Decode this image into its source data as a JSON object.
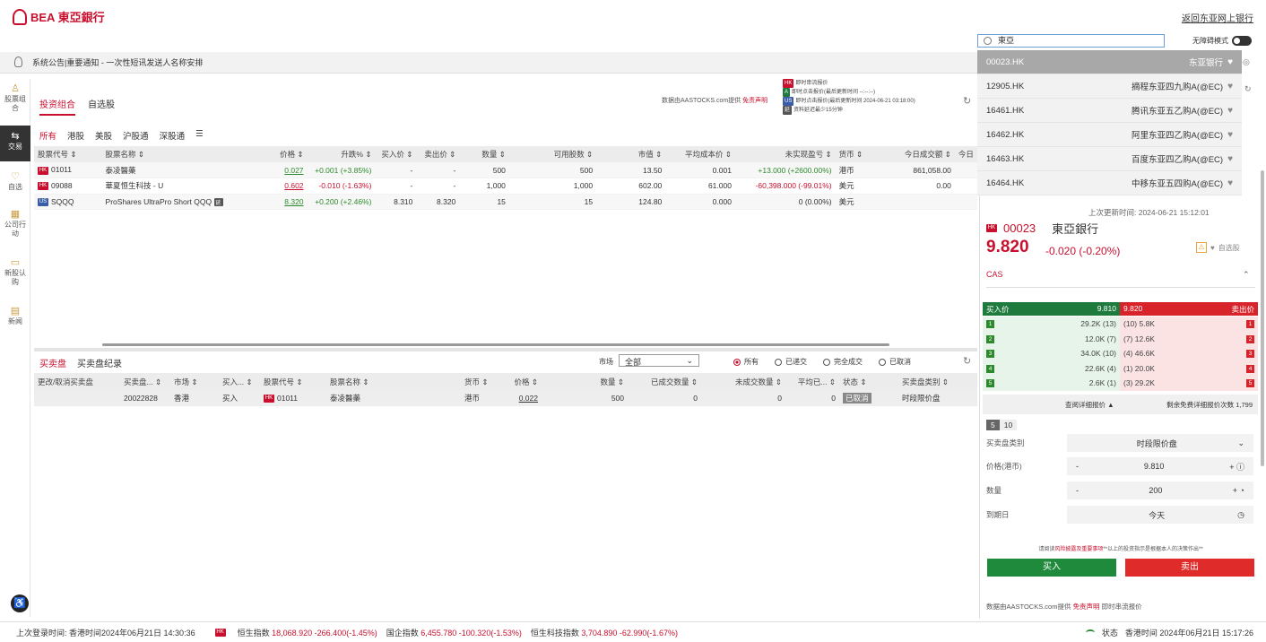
{
  "app": {
    "logo_text": "BEA 東亞銀行",
    "back_link": "返回东亚网上银行",
    "barrier_free": "无障碍模式"
  },
  "search": {
    "value": "東亞"
  },
  "notice": {
    "text": "系统公告|重要通知 - 一次性短讯发送人名称安排"
  },
  "sidebar": {
    "items": [
      {
        "label": "股票组合",
        "icon": "person-icon"
      },
      {
        "label": "交易",
        "icon": "trade-icon"
      },
      {
        "label": "自选",
        "icon": "heart-icon"
      },
      {
        "label": "公司行动",
        "icon": "calendar-icon"
      },
      {
        "label": "新股认购",
        "icon": "ipo-icon"
      },
      {
        "label": "新闻",
        "icon": "news-icon"
      }
    ]
  },
  "tabs": [
    "投资组合",
    "自选股"
  ],
  "legend": [
    {
      "badge": "HK",
      "text": "即时串流报价"
    },
    {
      "badge": "A",
      "text": "即时点击报价(最后更新时间 --:--:--)"
    },
    {
      "badge": "US",
      "text": "即时点击报价(最后更新时间 2024-06-21 03:18:00)"
    },
    {
      "badge": "延",
      "text": "资料延迟最少15分钟"
    }
  ],
  "aastocks": {
    "prefix": "数据由AASTOCKS.com提供",
    "link": "免责声明"
  },
  "markets": [
    "所有",
    "港股",
    "美股",
    "沪股通",
    "深股通",
    "☰"
  ],
  "portfolio": {
    "headers": [
      "股票代号 ⇕",
      "股票名称 ⇕",
      "价格 ⇕",
      "升跌% ⇕",
      "买入价 ⇕",
      "卖出价 ⇕",
      "数量 ⇕",
      "可用股数 ⇕",
      "市值 ⇕",
      "平均成本价 ⇕",
      "未实现盈亏 ⇕",
      "货币 ⇕",
      "今日成交额 ⇕",
      "今日"
    ],
    "rows": [
      {
        "mkt": "HK",
        "code": "01011",
        "name": "泰凌醫藥",
        "price": "0.027",
        "chg": "+0.001 (+3.85%)",
        "bid": "-",
        "ask": "-",
        "qty": "500",
        "avail": "500",
        "mv": "13.50",
        "cost": "0.001",
        "pl": "+13.000 (+2600.00%)",
        "ccy": "港币",
        "turnover": "861,058.00"
      },
      {
        "mkt": "HK",
        "code": "09088",
        "name": "華夏恒生科技 - U",
        "price": "0.602",
        "chg": "-0.010 (-1.63%)",
        "bid": "-",
        "ask": "-",
        "qty": "1,000",
        "avail": "1,000",
        "mv": "602.00",
        "cost": "61.000",
        "pl": "-60,398.000 (-99.01%)",
        "ccy": "美元",
        "turnover": "0.00"
      },
      {
        "mkt": "US",
        "code": "SQQQ",
        "name": "ProShares UltraPro Short QQQ",
        "price": "8.320",
        "chg": "+0.200 (+2.46%)",
        "bid": "8.310",
        "ask": "8.320",
        "qty": "15",
        "avail": "15",
        "mv": "124.80",
        "cost": "0.000",
        "pl": "0 (0.00%)",
        "ccy": "美元",
        "turnover": ""
      }
    ]
  },
  "orders": {
    "tabs": [
      "买卖盘",
      "买卖盘纪录"
    ],
    "market_label": "市场",
    "market_value": "全部",
    "filters": [
      "所有",
      "已递交",
      "完全成交",
      "已取消"
    ],
    "headers": [
      "更改/取消买卖盘",
      "买卖盘... ⇕",
      "市场 ⇕",
      "买入... ⇕",
      "股票代号 ⇕",
      "股票名称 ⇕",
      "货币 ⇕",
      "价格 ⇕",
      "数量 ⇕",
      "已成交数量 ⇕",
      "未成交数量 ⇕",
      "平均已... ⇕",
      "状态 ⇕",
      "买卖盘类别 ⇕"
    ],
    "rows": [
      {
        "action": "",
        "id": "20022828",
        "market": "香港",
        "side": "买入",
        "mkt": "HK",
        "code": "01011",
        "name": "泰凌醫藥",
        "ccy": "港币",
        "price": "0.022",
        "qty": "500",
        "filled": "0",
        "unfilled": "0",
        "avg": "0",
        "status": "已取消",
        "type": "时段限价盘"
      }
    ]
  },
  "search_results": [
    {
      "code": "00023.HK",
      "name": "东亚银行"
    },
    {
      "code": "12905.HK",
      "name": "摘程东亚四九购A(@EC)"
    },
    {
      "code": "16461.HK",
      "name": "腾讯东亚五乙购A(@EC)"
    },
    {
      "code": "16462.HK",
      "name": "阿里东亚四乙购A(@EC)"
    },
    {
      "code": "16463.HK",
      "name": "百度东亚四乙购A(@EC)"
    },
    {
      "code": "16464.HK",
      "name": "中移东亚五四购A(@EC)"
    }
  ],
  "quote": {
    "last_update": "上次更新时间: 2024-06-21 15:12:01",
    "code": "00023",
    "name": "東亞銀行",
    "price": "9.820",
    "change": "-0.020 (-0.20%)",
    "watch_label": "自选股",
    "cas": "CAS",
    "bid_label": "买入价",
    "bid_price": "9.810",
    "ask_label": "卖出价",
    "ask_price": "9.820",
    "bids": [
      "29.2K (13)",
      "12.0K (7)",
      "34.0K (10)",
      "22.6K (4)",
      "2.6K (1)"
    ],
    "asks": [
      "(10) 5.8K",
      "(7) 12.6K",
      "(4) 46.6K",
      "(1) 20.0K",
      "(3) 29.2K"
    ],
    "depth_link": "查阅详细报价 ▲",
    "remaining": "剩余免费详细报价次数 1,799",
    "levels": [
      "5",
      "10"
    ]
  },
  "order_form": {
    "type_label": "买卖盘类别",
    "type_value": "时段限价盘",
    "price_label": "价格(港币)",
    "price_value": "9.810",
    "qty_label": "数量",
    "qty_value": "200",
    "expiry_label": "到期日",
    "expiry_value": "今天",
    "disclaimer_pre": "请阅读",
    "disclaimer_link": "风险披露及重要事项",
    "disclaimer_post": "**以上的投资指示是根据本人的决策作出**",
    "buy": "买入",
    "sell": "卖出",
    "aastocks": "数据由AASTOCKS.com提供",
    "aastocks_link": "免责声明",
    "aastocks_tail": "即时串流报价"
  },
  "footer": {
    "login": "上次登录时间: 香港时间2024年06月21日 14:30:36",
    "hsi_label": "恒生指数",
    "hsi": "18,068.920 -266.400(-1.45%)",
    "hscei_label": "国企指数",
    "hscei": "6,455.780 -100.320(-1.53%)",
    "hstech_label": "恒生科技指数",
    "hstech": "3,704.890 -62.990(-1.67%)",
    "status": "状态",
    "time": "香港时间 2024年06月21日 15:17:26"
  }
}
